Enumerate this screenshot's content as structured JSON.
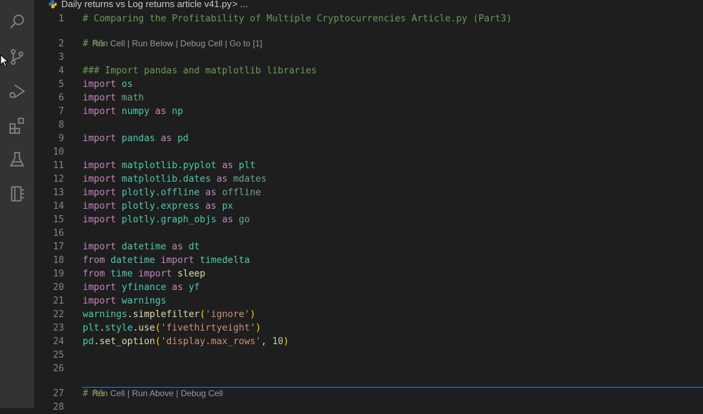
{
  "breadcrumb": {
    "file": "Daily returns vs Log returns article v41.py",
    "separator": ">",
    "more": "..."
  },
  "activity_bar": {
    "icons": [
      "search-icon",
      "source-control-icon",
      "run-debug-icon",
      "extensions-icon",
      "testing-icon",
      "notebook-icon"
    ]
  },
  "code_lens": {
    "top": [
      "Run Cell",
      "|",
      "Run Below",
      "|",
      "Debug Cell",
      "|",
      "Go to [1]"
    ],
    "bottom": [
      "Run Cell",
      "|",
      "Run Above",
      "|",
      "Debug Cell"
    ]
  },
  "lines": [
    {
      "n": "1",
      "tokens": [
        [
          "cm",
          "# Comparing the Profitability of Multiple Cryptocurrencies Article.py (Part3)"
        ]
      ]
    },
    {
      "n": "2",
      "tokens": [
        [
          "cm",
          "# %%"
        ]
      ]
    },
    {
      "n": "3",
      "tokens": []
    },
    {
      "n": "4",
      "tokens": [
        [
          "cm",
          "### Import pandas and matplotlib libraries"
        ]
      ]
    },
    {
      "n": "5",
      "tokens": [
        [
          "kw",
          "import"
        ],
        [
          "tx",
          " "
        ],
        [
          "mod",
          "os"
        ]
      ]
    },
    {
      "n": "6",
      "tokens": [
        [
          "kw",
          "import"
        ],
        [
          "tx",
          " "
        ],
        [
          "mod2",
          "math"
        ]
      ]
    },
    {
      "n": "7",
      "tokens": [
        [
          "kw",
          "import"
        ],
        [
          "tx",
          " "
        ],
        [
          "mod",
          "numpy"
        ],
        [
          "tx",
          " "
        ],
        [
          "kw",
          "as"
        ],
        [
          "tx",
          " "
        ],
        [
          "mod",
          "np"
        ]
      ]
    },
    {
      "n": "8",
      "tokens": []
    },
    {
      "n": "9",
      "tokens": [
        [
          "kw",
          "import"
        ],
        [
          "tx",
          " "
        ],
        [
          "mod",
          "pandas"
        ],
        [
          "tx",
          " "
        ],
        [
          "kw",
          "as"
        ],
        [
          "tx",
          " "
        ],
        [
          "mod",
          "pd"
        ]
      ]
    },
    {
      "n": "10",
      "tokens": []
    },
    {
      "n": "11",
      "tokens": [
        [
          "kw",
          "import"
        ],
        [
          "tx",
          " "
        ],
        [
          "mod",
          "matplotlib.pyplot"
        ],
        [
          "tx",
          " "
        ],
        [
          "kw",
          "as"
        ],
        [
          "tx",
          " "
        ],
        [
          "mod",
          "plt"
        ]
      ]
    },
    {
      "n": "12",
      "tokens": [
        [
          "kw",
          "import"
        ],
        [
          "tx",
          " "
        ],
        [
          "mod",
          "matplotlib.dates"
        ],
        [
          "tx",
          " "
        ],
        [
          "kw",
          "as"
        ],
        [
          "tx",
          " "
        ],
        [
          "mod2",
          "mdates"
        ]
      ]
    },
    {
      "n": "13",
      "tokens": [
        [
          "kw",
          "import"
        ],
        [
          "tx",
          " "
        ],
        [
          "mod",
          "plotly.offline"
        ],
        [
          "tx",
          " "
        ],
        [
          "kw",
          "as"
        ],
        [
          "tx",
          " "
        ],
        [
          "mod2",
          "offline"
        ]
      ]
    },
    {
      "n": "14",
      "tokens": [
        [
          "kw",
          "import"
        ],
        [
          "tx",
          " "
        ],
        [
          "mod",
          "plotly.express"
        ],
        [
          "tx",
          " "
        ],
        [
          "kw",
          "as"
        ],
        [
          "tx",
          " "
        ],
        [
          "mod",
          "px"
        ]
      ]
    },
    {
      "n": "15",
      "tokens": [
        [
          "kw",
          "import"
        ],
        [
          "tx",
          " "
        ],
        [
          "mod",
          "plotly.graph_objs"
        ],
        [
          "tx",
          " "
        ],
        [
          "kw",
          "as"
        ],
        [
          "tx",
          " "
        ],
        [
          "mod2",
          "go"
        ]
      ]
    },
    {
      "n": "16",
      "tokens": []
    },
    {
      "n": "17",
      "tokens": [
        [
          "kw",
          "import"
        ],
        [
          "tx",
          " "
        ],
        [
          "mod",
          "datetime"
        ],
        [
          "tx",
          " "
        ],
        [
          "kw",
          "as"
        ],
        [
          "tx",
          " "
        ],
        [
          "mod",
          "dt"
        ]
      ]
    },
    {
      "n": "18",
      "tokens": [
        [
          "kw",
          "from"
        ],
        [
          "tx",
          " "
        ],
        [
          "mod",
          "datetime"
        ],
        [
          "tx",
          " "
        ],
        [
          "kw",
          "import"
        ],
        [
          "tx",
          " "
        ],
        [
          "mod",
          "timedelta"
        ]
      ]
    },
    {
      "n": "19",
      "tokens": [
        [
          "kw",
          "from"
        ],
        [
          "tx",
          " "
        ],
        [
          "mod",
          "time"
        ],
        [
          "tx",
          " "
        ],
        [
          "kw",
          "import"
        ],
        [
          "tx",
          " "
        ],
        [
          "fn",
          "sleep"
        ]
      ]
    },
    {
      "n": "20",
      "tokens": [
        [
          "kw",
          "import"
        ],
        [
          "tx",
          " "
        ],
        [
          "mod",
          "yfinance"
        ],
        [
          "tx",
          " "
        ],
        [
          "kw",
          "as"
        ],
        [
          "tx",
          " "
        ],
        [
          "mod",
          "yf"
        ]
      ]
    },
    {
      "n": "21",
      "tokens": [
        [
          "kw",
          "import"
        ],
        [
          "tx",
          " "
        ],
        [
          "mod",
          "warnings"
        ]
      ]
    },
    {
      "n": "22",
      "tokens": [
        [
          "mod",
          "warnings"
        ],
        [
          "tx",
          "."
        ],
        [
          "fn",
          "simplefilter"
        ],
        [
          "brk",
          "("
        ],
        [
          "str",
          "'ignore'"
        ],
        [
          "brk",
          ")"
        ]
      ]
    },
    {
      "n": "23",
      "tokens": [
        [
          "mod",
          "plt"
        ],
        [
          "tx",
          "."
        ],
        [
          "mod",
          "style"
        ],
        [
          "tx",
          "."
        ],
        [
          "fn",
          "use"
        ],
        [
          "brk",
          "("
        ],
        [
          "str",
          "'fivethirtyeight'"
        ],
        [
          "brk",
          ")"
        ]
      ]
    },
    {
      "n": "24",
      "tokens": [
        [
          "mod",
          "pd"
        ],
        [
          "tx",
          "."
        ],
        [
          "fn",
          "set_option"
        ],
        [
          "brk",
          "("
        ],
        [
          "str",
          "'display.max_rows'"
        ],
        [
          "tx",
          ", "
        ],
        [
          "num",
          "10"
        ],
        [
          "brk",
          ")"
        ]
      ]
    },
    {
      "n": "25",
      "tokens": []
    },
    {
      "n": "26",
      "tokens": []
    },
    {
      "n": "27",
      "tokens": [
        [
          "cm",
          "# %%"
        ]
      ]
    },
    {
      "n": "28",
      "tokens": []
    }
  ],
  "colors": {
    "background": "#1e1e1e",
    "activity_bar": "#333333",
    "cell_divider": "#2f79d8"
  }
}
